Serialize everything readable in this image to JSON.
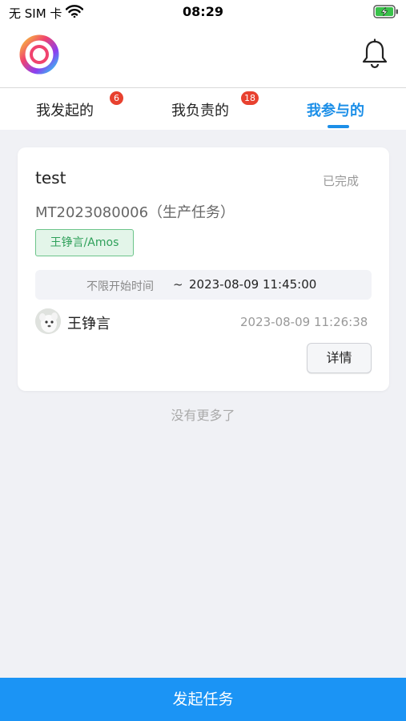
{
  "status_bar": {
    "carrier": "无 SIM 卡",
    "time": "08:29"
  },
  "tabs": [
    {
      "label": "我发起的",
      "badge": "6",
      "active": false
    },
    {
      "label": "我负责的",
      "badge": "18",
      "active": false
    },
    {
      "label": "我参与的",
      "badge": "",
      "active": true
    }
  ],
  "task": {
    "title": "test",
    "status": "已完成",
    "code": "MT2023080006（生产任务）",
    "tag": "王铮言/Amos",
    "start_label": "不限开始时间",
    "separator": "~",
    "end_time": "2023-08-09 11:45:00",
    "person": "王铮言",
    "created_at": "2023-08-09 11:26:38",
    "detail_label": "详情"
  },
  "list_footer": "没有更多了",
  "bottom_button": "发起任务",
  "colors": {
    "accent": "#1c8fe8",
    "badge": "#e8412f",
    "tag_green": "#2fa05a",
    "bottom_bar": "#1b94f5",
    "battery_green": "#39c24a"
  },
  "icons": {
    "logo": "app-ring-logo",
    "notification": "bell-icon",
    "wifi": "wifi-icon",
    "battery": "battery-charging-icon"
  }
}
